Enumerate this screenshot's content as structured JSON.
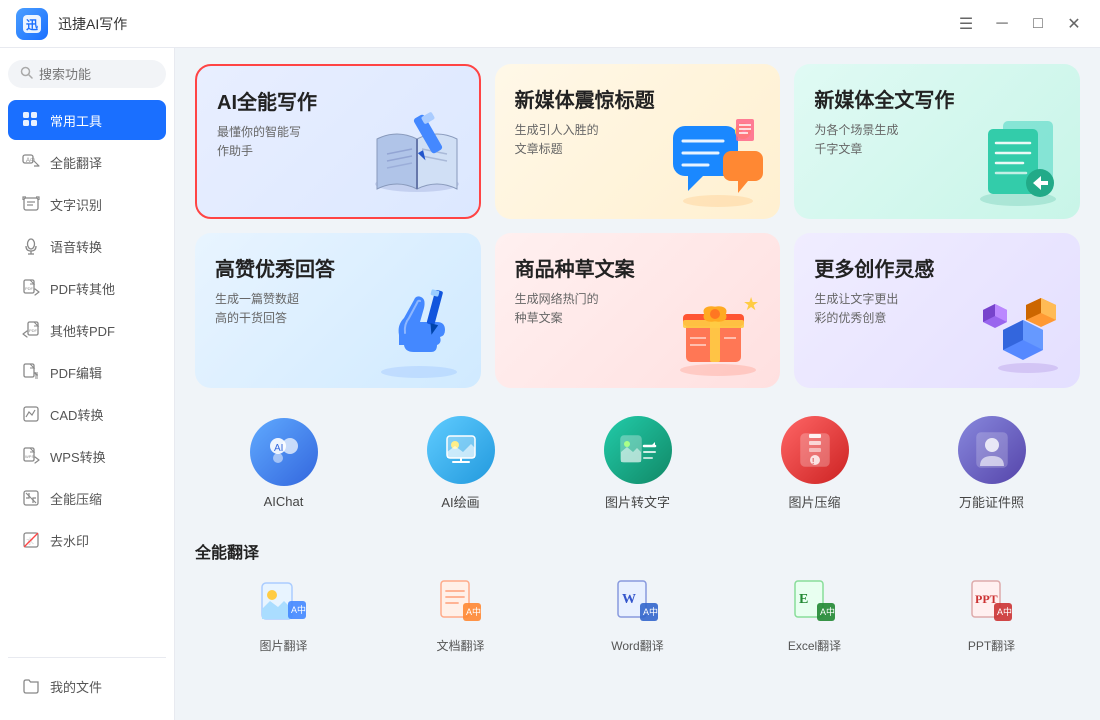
{
  "titlebar": {
    "app_name": "迅捷AI写作",
    "logo_text": "迅",
    "controls": {
      "menu": "☰",
      "minimize": "─",
      "maximize": "□",
      "close": "✕"
    }
  },
  "sidebar": {
    "search_placeholder": "搜索功能",
    "items": [
      {
        "id": "common-tools",
        "label": "常用工具",
        "icon": "grid",
        "active": true
      },
      {
        "id": "all-translate",
        "label": "全能翻译",
        "icon": "translate"
      },
      {
        "id": "ocr",
        "label": "文字识别",
        "icon": "text-recognition"
      },
      {
        "id": "speech",
        "label": "语音转换",
        "icon": "speech"
      },
      {
        "id": "pdf-to-other",
        "label": "PDF转其他",
        "icon": "pdf-convert"
      },
      {
        "id": "other-to-pdf",
        "label": "其他转PDF",
        "icon": "to-pdf"
      },
      {
        "id": "pdf-edit",
        "label": "PDF编辑",
        "icon": "pdf-edit"
      },
      {
        "id": "cad",
        "label": "CAD转换",
        "icon": "cad"
      },
      {
        "id": "wps",
        "label": "WPS转换",
        "icon": "wps"
      },
      {
        "id": "compress",
        "label": "全能压缩",
        "icon": "compress"
      },
      {
        "id": "watermark",
        "label": "去水印",
        "icon": "watermark"
      }
    ],
    "bottom_item": {
      "id": "my-files",
      "label": "我的文件",
      "icon": "folder"
    }
  },
  "main": {
    "featured_cards": [
      {
        "id": "ai-writing",
        "title": "AI全能写作",
        "desc": "最懂你的智能写\n作助手",
        "bg": "card-1",
        "icon_type": "book-pen"
      },
      {
        "id": "new-media-title",
        "title": "新媒体震惊标题",
        "desc": "生成引人入胜的\n文章标题",
        "bg": "card-2",
        "icon_type": "chat-bubbles"
      },
      {
        "id": "new-media-full",
        "title": "新媒体全文写作",
        "desc": "为各个场景生成\n千字文章",
        "bg": "card-3",
        "icon_type": "document-stack"
      }
    ],
    "mid_cards": [
      {
        "id": "high-praise-answer",
        "title": "高赞优秀回答",
        "desc": "生成一篇赞数超\n高的干货回答",
        "bg": "card-4",
        "icon_type": "hand-writing"
      },
      {
        "id": "product-seeding",
        "title": "商品种草文案",
        "desc": "生成网络热门的\n种草文案",
        "bg": "card-5",
        "icon_type": "product-card"
      },
      {
        "id": "more-inspiration",
        "title": "更多创作灵感",
        "desc": "生成让文字更出\n彩的优秀创意",
        "bg": "card-6",
        "icon_type": "cubes"
      }
    ],
    "icon_tools": [
      {
        "id": "aichat",
        "label": "AIChat",
        "icon_class": "ic-aichat"
      },
      {
        "id": "ai-draw",
        "label": "AI绘画",
        "icon_class": "ic-aidraw"
      },
      {
        "id": "img-to-text",
        "label": "图片转文字",
        "icon_class": "ic-img2txt"
      },
      {
        "id": "img-compress",
        "label": "图片压缩",
        "icon_class": "ic-imgzip"
      },
      {
        "id": "id-photo",
        "label": "万能证件照",
        "icon_class": "ic-idphoto"
      }
    ],
    "section_translate": "全能翻译",
    "translate_icons": [
      {
        "id": "img-translate",
        "label": "图片翻译"
      },
      {
        "id": "doc-translate",
        "label": "文档翻译"
      },
      {
        "id": "word-translate",
        "label": "Word翻译"
      },
      {
        "id": "excel-translate",
        "label": "Excel翻译"
      },
      {
        "id": "ppt-translate",
        "label": "PPT翻译"
      }
    ]
  }
}
